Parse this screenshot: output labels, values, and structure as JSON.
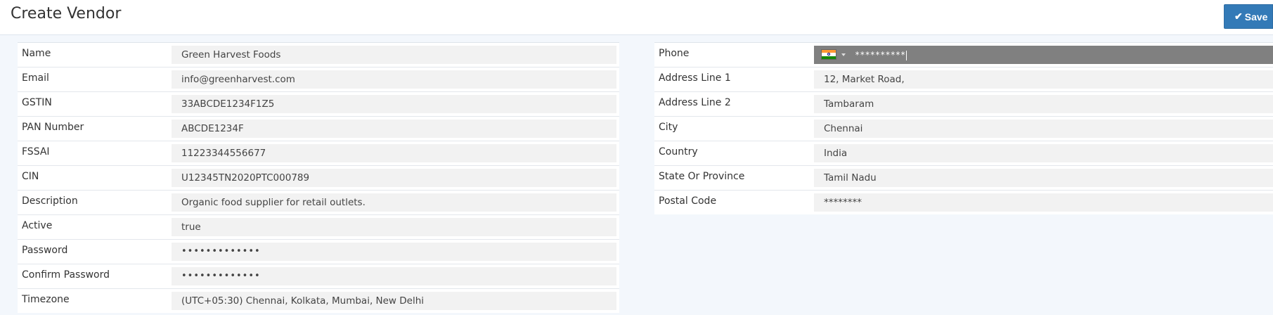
{
  "header": {
    "title": "Create Vendor",
    "save_label": "Save",
    "save_icon": "check-icon",
    "accent": "#337ab7"
  },
  "left_fields": [
    {
      "label": "Name",
      "value": "Green Harvest Foods"
    },
    {
      "label": "Email",
      "value": "info@greenharvest.com"
    },
    {
      "label": "GSTIN",
      "value": "33ABCDE1234F1Z5"
    },
    {
      "label": "PAN Number",
      "value": "ABCDE1234F"
    },
    {
      "label": "FSSAI",
      "value": "11223344556677"
    },
    {
      "label": "CIN",
      "value": "U12345TN2020PTC000789"
    },
    {
      "label": "Description",
      "value": "Organic food supplier for retail outlets."
    },
    {
      "label": "Active",
      "value": "true"
    },
    {
      "label": "Password",
      "value": "•••••••••••••"
    },
    {
      "label": "Confirm Password",
      "value": "•••••••••••••"
    },
    {
      "label": "Timezone",
      "value": "(UTC+05:30) Chennai, Kolkata, Mumbai, New Delhi"
    }
  ],
  "right_fields": [
    {
      "label": "Phone",
      "value": "**********",
      "flag": "india-flag-icon"
    },
    {
      "label": "Address Line 1",
      "value": "12, Market Road,"
    },
    {
      "label": "Address Line 2",
      "value": "Tambaram"
    },
    {
      "label": "City",
      "value": "Chennai"
    },
    {
      "label": "Country",
      "value": "India"
    },
    {
      "label": "State Or Province",
      "value": "Tamil Nadu"
    },
    {
      "label": "Postal Code",
      "value": "********"
    }
  ]
}
